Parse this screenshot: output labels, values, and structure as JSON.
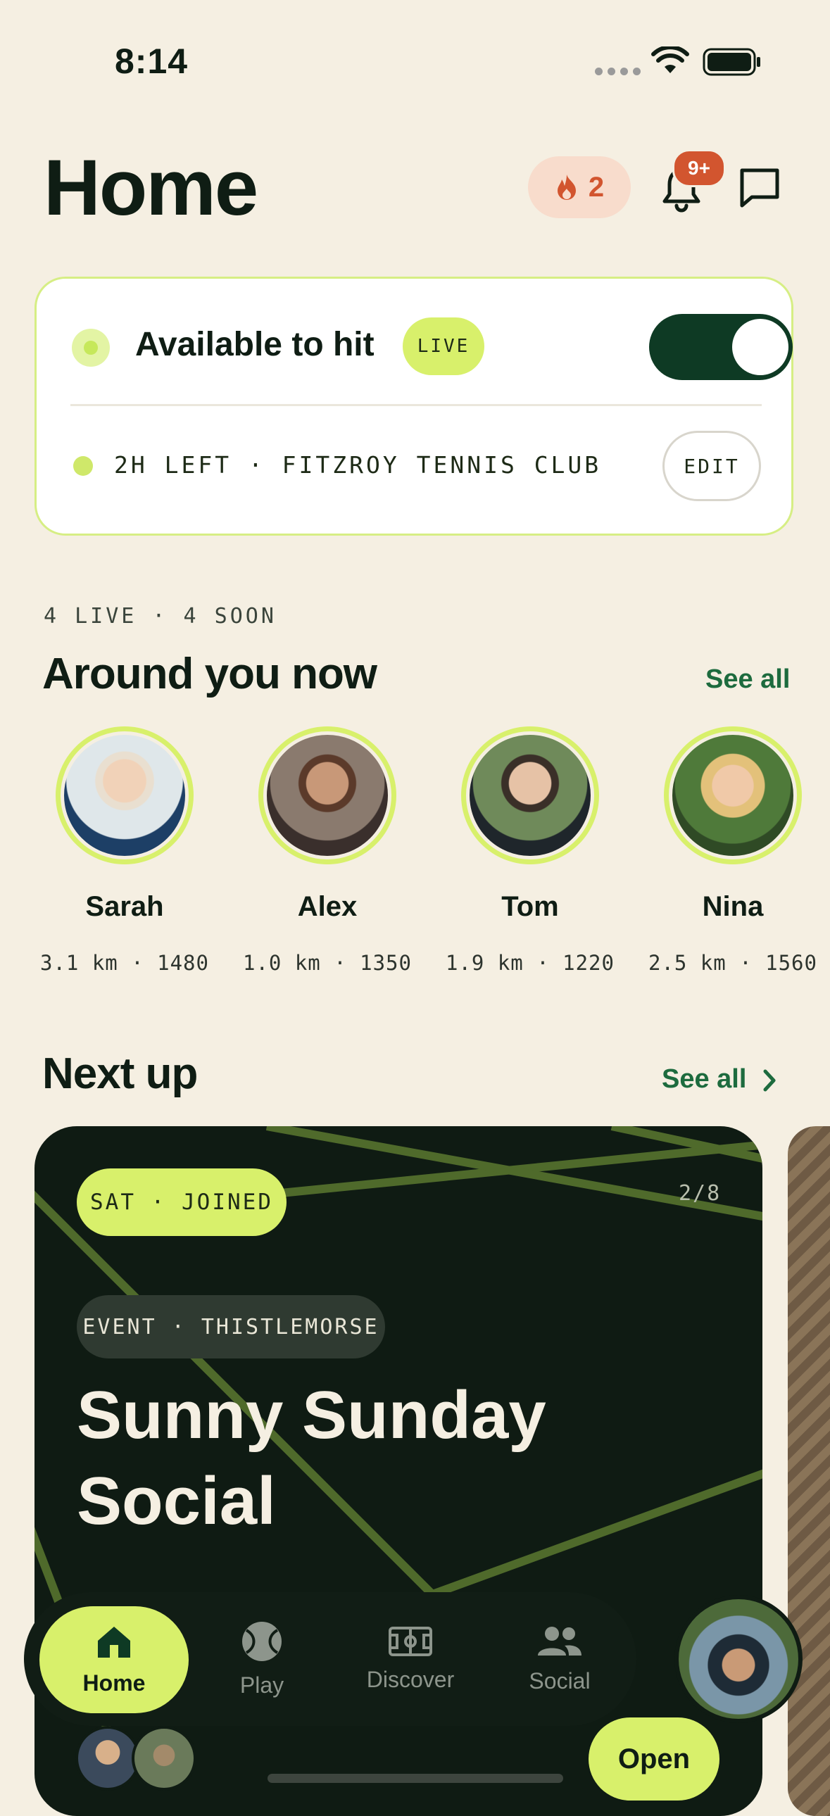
{
  "status_bar": {
    "time": "8:14"
  },
  "header": {
    "title": "Home",
    "streak_count": "2",
    "notifications_badge": "9+"
  },
  "availability": {
    "label": "Available to hit",
    "live_tag": "LIVE",
    "toggle_on": true,
    "details": "2H LEFT · FITZROY TENNIS CLUB",
    "edit_label": "EDIT"
  },
  "around": {
    "meta": "4 LIVE · 4 SOON",
    "title": "Around you now",
    "see_all": "See all",
    "players": [
      {
        "name": "Sarah",
        "stats": "3.1 km · 1480"
      },
      {
        "name": "Alex",
        "stats": "1.0 km · 1350"
      },
      {
        "name": "Tom",
        "stats": "1.9 km · 1220"
      },
      {
        "name": "Nina",
        "stats": "2.5 km · 1560"
      }
    ]
  },
  "next_up": {
    "title": "Next up",
    "see_all": "See all",
    "event": {
      "day_status": "SAT · JOINED",
      "count": "2/8",
      "type": "EVENT · THISTLEMORSE",
      "title": "Sunny Sunday Social",
      "open_label": "Open"
    }
  },
  "tabs": [
    {
      "label": "Home",
      "active": true
    },
    {
      "label": "Play",
      "active": false
    },
    {
      "label": "Discover",
      "active": false
    },
    {
      "label": "Social",
      "active": false
    }
  ],
  "colors": {
    "accent": "#d8f06b",
    "dark": "#0f1b13",
    "background": "#f5efe2",
    "link": "#1d6b3e",
    "alert": "#d2552f"
  }
}
